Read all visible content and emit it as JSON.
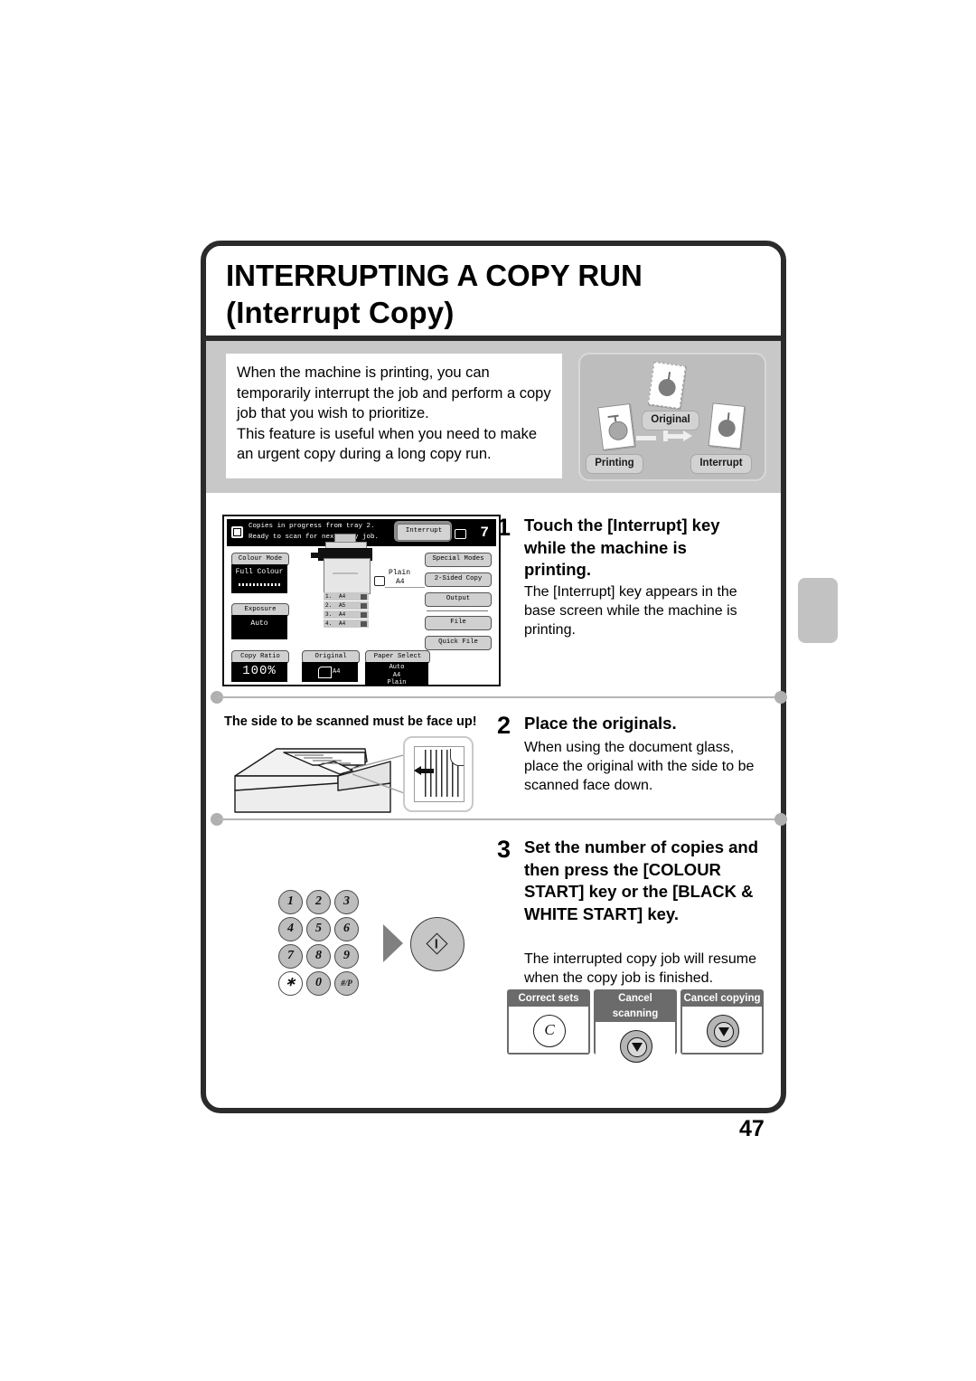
{
  "page": {
    "number": "47"
  },
  "header": {
    "title_line1": "INTERRUPTING A COPY RUN",
    "title_line2": "(Interrupt Copy)"
  },
  "intro": {
    "paragraph1": "When the machine is printing, you can temporarily interrupt the job and perform a copy job that you wish to prioritize.",
    "paragraph2": "This feature is useful when you need to make an urgent copy during a long copy run.",
    "diagram": {
      "label_printing": "Printing",
      "label_original": "Original",
      "label_interrupt": "Interrupt"
    }
  },
  "steps": [
    {
      "number": "1",
      "heading": "Touch the [Interrupt] key while the machine is printing.",
      "body": "The [Interrupt] key appears in the base screen while the machine is printing."
    },
    {
      "number": "2",
      "heading": "Place the originals.",
      "body": "When using the document glass, place the original with the side to be scanned face down.",
      "caption": "The side to be scanned must be face up!"
    },
    {
      "number": "3",
      "heading": "Set the number of copies and then press the [COLOUR START] key or the [BLACK & WHITE START] key.",
      "body": "The interrupted copy job will resume when the copy job is finished."
    }
  ],
  "lcd": {
    "status_line1": "Copies in progress from tray 2.",
    "status_line2": "Ready to scan for next copy job.",
    "interrupt_key": "Interrupt",
    "copy_count": "7",
    "left_buttons": [
      {
        "label": "Colour Mode",
        "value": "Full Colour"
      },
      {
        "label": "Exposure",
        "value": "Auto"
      },
      {
        "label": "Copy Ratio",
        "value": "100%"
      }
    ],
    "right_buttons": [
      "Special Modes",
      "2-Sided Copy",
      "Output",
      "File",
      "Quick File"
    ],
    "bottom_buttons": [
      {
        "label": "Original",
        "value": "A4"
      },
      {
        "label": "Paper Select",
        "value": "Auto\nA4\nPlain"
      }
    ],
    "paper_callout_line1": "Plain",
    "paper_callout_line2": "A4",
    "trays": [
      {
        "no": "1.",
        "size": "A4"
      },
      {
        "no": "2.",
        "size": "A5"
      },
      {
        "no": "3.",
        "size": "A4"
      },
      {
        "no": "4.",
        "size": "A4"
      }
    ]
  },
  "keypad": {
    "keys": [
      "1",
      "2",
      "3",
      "4",
      "5",
      "6",
      "7",
      "8",
      "9",
      "∗",
      "0",
      "#/P"
    ]
  },
  "callouts": [
    {
      "label": "Correct sets",
      "glyph": "C"
    },
    {
      "label": "Cancel scanning",
      "glyph": "stop"
    },
    {
      "label": "Cancel copying",
      "glyph": "stop"
    }
  ],
  "colors": {
    "frame": "#2b2b2b",
    "band": "#c8c8c8",
    "accent_grey": "#6b6b6b"
  }
}
